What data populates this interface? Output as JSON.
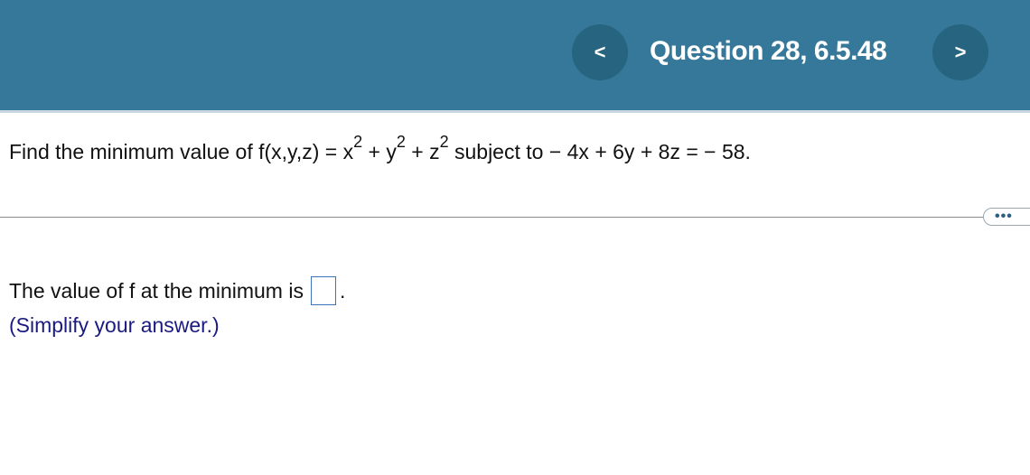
{
  "header": {
    "title": "Question 28, 6.5.48",
    "prev_icon": "<",
    "next_icon": ">"
  },
  "question": {
    "lead": "Find the minimum value of f(x,y,z) = x",
    "exp1": "2",
    "mid1": " + y",
    "exp2": "2",
    "mid2": " + z",
    "exp3": "2",
    "tail": " subject to  − 4x + 6y + 8z =  − 58."
  },
  "more_label": "•••",
  "answer": {
    "prefix": "The value of f at the minimum is",
    "value": "",
    "suffix": ".",
    "hint": "(Simplify your answer.)"
  },
  "colors": {
    "header_bg": "#367899",
    "nav_button_bg": "#26647f",
    "hint_text": "#1a1a80",
    "answer_box_border": "#3d73b8"
  }
}
